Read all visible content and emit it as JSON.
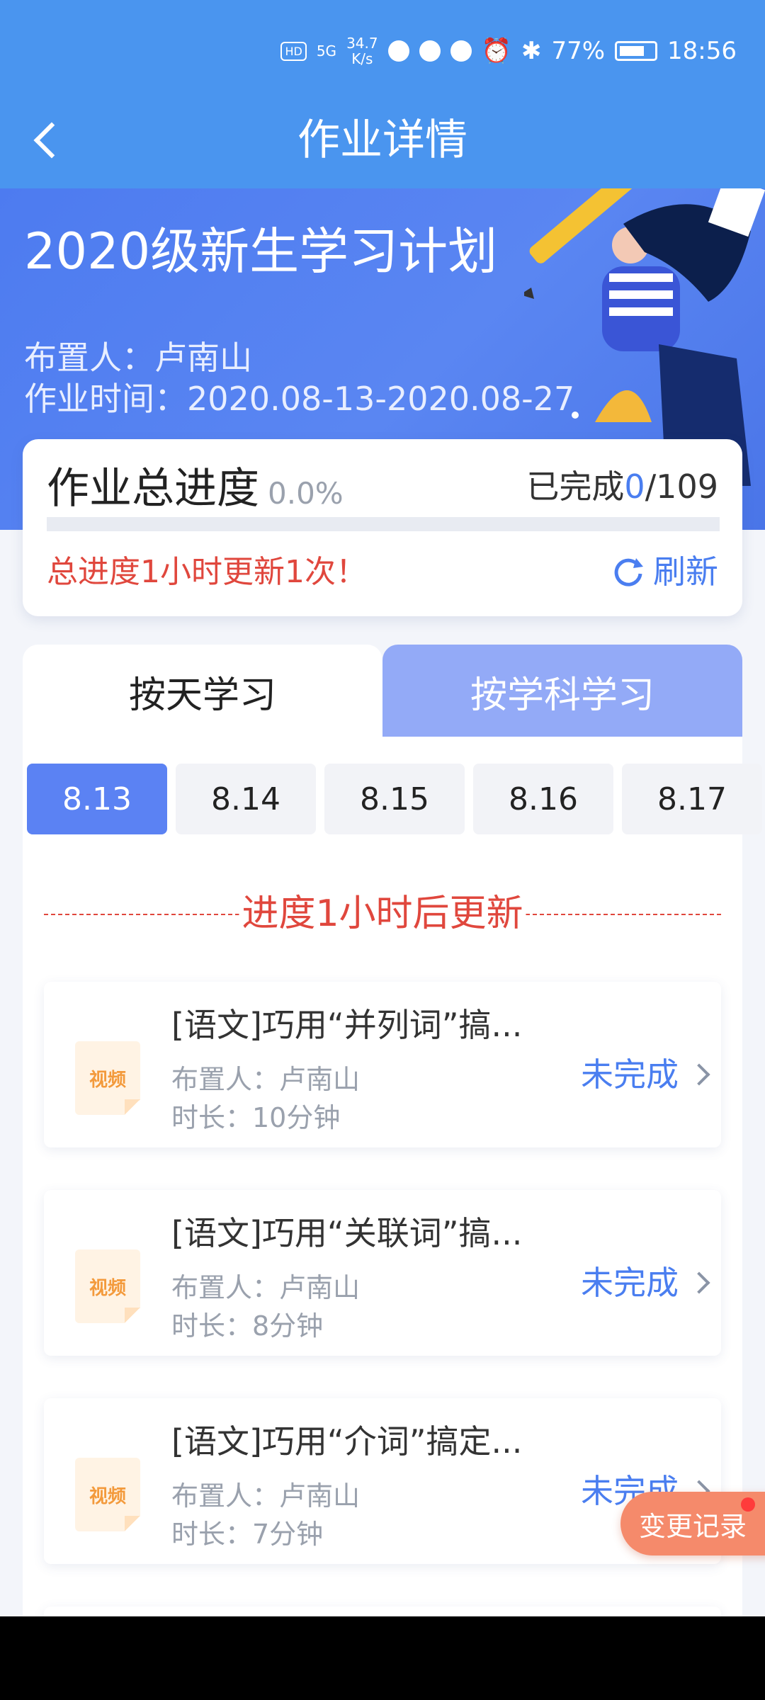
{
  "status_bar": {
    "network_speed_value": "34.7",
    "network_speed_unit": "K/s",
    "battery": "77%",
    "time": "18:56",
    "hd_label": "HD",
    "signal_label": "5G"
  },
  "nav": {
    "title": "作业详情",
    "back_icon": "chevron-left-icon"
  },
  "hero": {
    "plan_title": "2020级新生学习计划",
    "assigner": "布置人：卢南山",
    "duration": "作业时间：2020.08-13-2020.08-27"
  },
  "progress": {
    "title": "作业总进度",
    "percent_label": "0.0%",
    "percent_value": 0.0,
    "done_prefix": "已完成",
    "done_count": "0",
    "total_suffix": "/109",
    "note": "总进度1小时更新1次！",
    "refresh_label": "刷新",
    "refresh_icon": "refresh-icon"
  },
  "tabs": [
    {
      "label": "按天学习",
      "active": true
    },
    {
      "label": "按学科学习",
      "active": false
    }
  ],
  "dates": [
    {
      "label": "8.13",
      "active": true
    },
    {
      "label": "8.14",
      "active": false
    },
    {
      "label": "8.15",
      "active": false
    },
    {
      "label": "8.16",
      "active": false
    },
    {
      "label": "8.17",
      "active": false
    }
  ],
  "update_notice": "进度1小时后更新",
  "tasks": [
    {
      "icon_label": "视频",
      "title": "[语文]巧用“并列词”搞...",
      "assigner": "布置人：卢南山",
      "duration": "时长：10分钟",
      "status": "未完成"
    },
    {
      "icon_label": "视频",
      "title": "[语文]巧用“关联词”搞...",
      "assigner": "布置人：卢南山",
      "duration": "时长：8分钟",
      "status": "未完成"
    },
    {
      "icon_label": "视频",
      "title": "[语文]巧用“介词”搞定...",
      "assigner": "布置人：卢南山",
      "duration": "时长：7分钟",
      "status": "未完成"
    }
  ],
  "float_button": {
    "label": "变更记录"
  },
  "colors": {
    "header_blue": "#4a95ef",
    "accent_blue": "#5b82f3",
    "alert_red": "#e0473d",
    "float_orange": "#f58a6b"
  }
}
